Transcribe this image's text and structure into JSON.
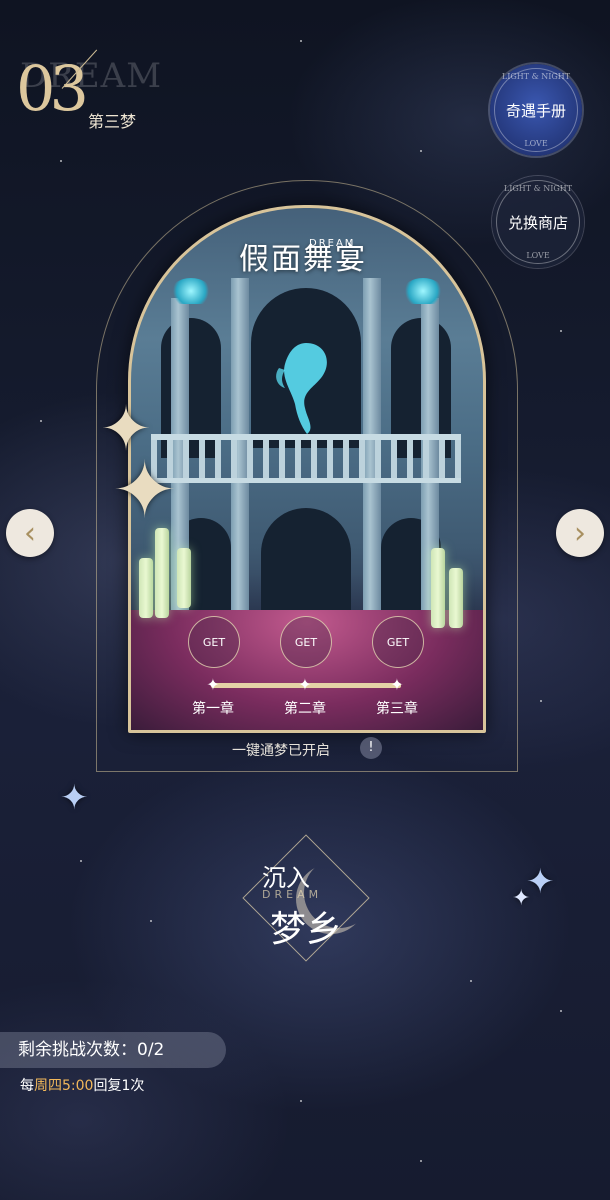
{
  "header": {
    "chapter_number": "03",
    "watermark": "DREAM",
    "chapter_name": "第三梦"
  },
  "side_buttons": {
    "handbook": {
      "label": "奇遇手册",
      "ring_text_top": "LIGHT & NIGHT",
      "ring_text_bottom": "LOVE"
    },
    "shop": {
      "label": "兑换商店",
      "ring_text_top": "LIGHT & NIGHT",
      "ring_text_bottom": "LOVE"
    }
  },
  "stage": {
    "title": "假面舞宴",
    "subtitle": "DREAM",
    "rewards": [
      "GET",
      "GET",
      "GET"
    ],
    "chapters": [
      "第一章",
      "第二章",
      "第三章"
    ]
  },
  "navigation": {
    "prev": "‹",
    "next": "›"
  },
  "one_key": {
    "text": "一键通梦已开启",
    "info": "!"
  },
  "enter_button": {
    "line1": "沉入",
    "line2": "梦乡",
    "overlay": "DREAM"
  },
  "challenge": {
    "label": "剩余挑战次数：0/2",
    "recover_prefix": "每",
    "recover_highlight": "周四5:00",
    "recover_suffix": "回复1次"
  },
  "colors": {
    "gold": "#d8c49a",
    "highlight": "#f2b85a",
    "handbook_bg": "#2c449a"
  }
}
